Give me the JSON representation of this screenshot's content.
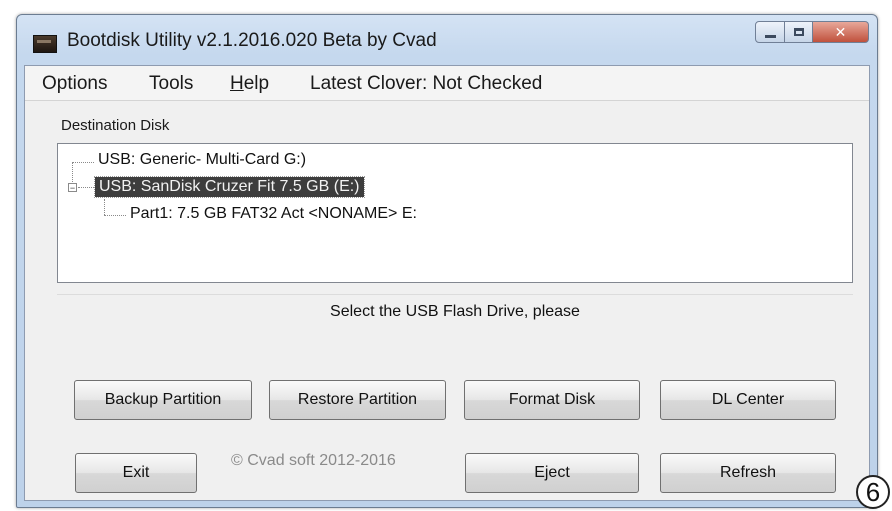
{
  "window": {
    "title": "Bootdisk Utility v2.1.2016.020 Beta by Cvad",
    "icon": "app-disk-icon"
  },
  "menu": {
    "options": "Options",
    "tools": "Tools",
    "help_underline": "H",
    "help_rest": "elp",
    "latest_clover": "Latest Clover: Not Checked"
  },
  "destination": {
    "label": "Destination Disk",
    "tree": {
      "node1": "USB: Generic- Multi-Card G:)",
      "node2": "USB: SanDisk Cruzer Fit 7.5 GB (E:)",
      "node2_expander": "−",
      "node2_child": "Part1: 7.5 GB FAT32 Act <NONAME> E:"
    }
  },
  "status": {
    "text": "Select the USB Flash Drive, please"
  },
  "buttons": {
    "backup": "Backup Partition",
    "restore": "Restore Partition",
    "format": "Format Disk",
    "dl_center": "DL Center",
    "exit": "Exit",
    "eject": "Eject",
    "refresh": "Refresh"
  },
  "copyright": "© Cvad soft 2012-2016",
  "corner_label": "6"
}
